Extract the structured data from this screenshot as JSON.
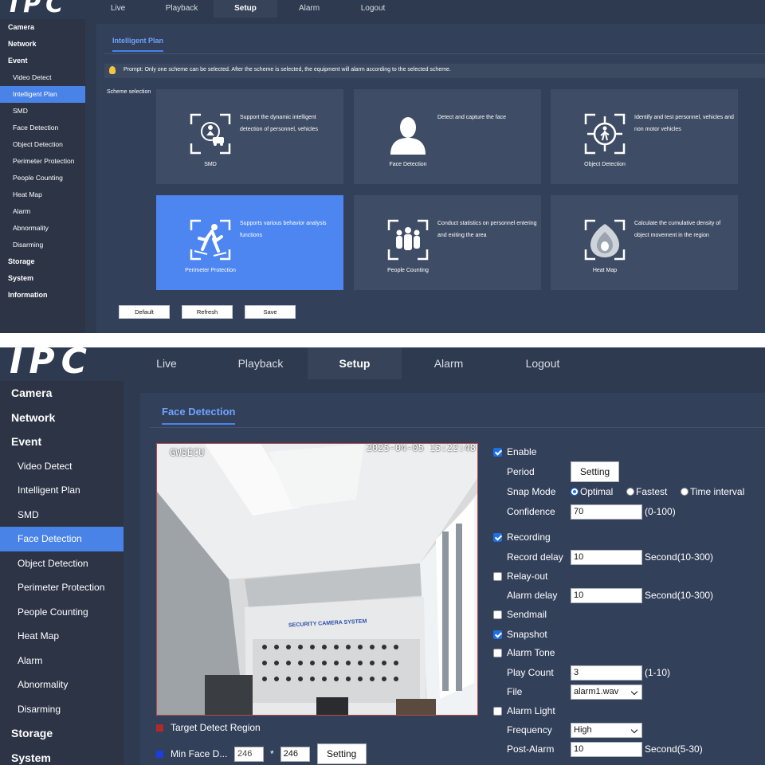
{
  "top_panel": {
    "logo_text": "IPC",
    "nav": [
      "Live",
      "Playback",
      "Setup",
      "Alarm",
      "Logout"
    ],
    "nav_active": 2,
    "sidebar": [
      {
        "label": "Camera",
        "group": true
      },
      {
        "label": "Network",
        "group": true
      },
      {
        "label": "Event",
        "group": true
      },
      {
        "label": "Video Detect",
        "group": false
      },
      {
        "label": "Intelligent Plan",
        "group": false,
        "active": true
      },
      {
        "label": "SMD",
        "group": false
      },
      {
        "label": "Face Detection",
        "group": false
      },
      {
        "label": "Object Detection",
        "group": false
      },
      {
        "label": "Perimeter Protection",
        "group": false
      },
      {
        "label": "People Counting",
        "group": false
      },
      {
        "label": "Heat Map",
        "group": false
      },
      {
        "label": "Alarm",
        "group": false
      },
      {
        "label": "Abnormality",
        "group": false
      },
      {
        "label": "Disarming",
        "group": false
      },
      {
        "label": "Storage",
        "group": true
      },
      {
        "label": "System",
        "group": true
      },
      {
        "label": "Information",
        "group": true
      }
    ],
    "tab_title": "Intelligent Plan",
    "prompt": "Prompt: Only one scheme can be selected. After the scheme is selected, the equipment will alarm according to the selected scheme.",
    "scheme_label": "Scheme selection",
    "cards": [
      {
        "name": "SMD",
        "desc": "Support the dynamic intelligent detection of personnel, vehicles",
        "icon": "smd-icon",
        "selected": false
      },
      {
        "name": "Face Detection",
        "desc": "Detect and capture the face",
        "icon": "face-icon",
        "selected": false
      },
      {
        "name": "Object Detection",
        "desc": "Identify and test personnel, vehicles and non motor vehicles",
        "icon": "object-icon",
        "selected": false
      },
      {
        "name": "Perimeter Protection",
        "desc": "Supports various behavior analysis functions",
        "icon": "perimeter-icon",
        "selected": true
      },
      {
        "name": "People Counting",
        "desc": "Conduct statistics on personnel entering and exiting the area",
        "icon": "people-icon",
        "selected": false
      },
      {
        "name": "Heat Map",
        "desc": "Calculate the cumulative density of object movement in the region",
        "icon": "heatmap-icon",
        "selected": false
      }
    ],
    "buttons": {
      "default": "Default",
      "refresh": "Refresh",
      "save": "Save"
    }
  },
  "bottom_panel": {
    "logo_text": "IPC",
    "nav": [
      "Live",
      "Playback",
      "Setup",
      "Alarm",
      "Logout"
    ],
    "nav_active": 2,
    "sidebar": [
      {
        "label": "Camera",
        "group": true
      },
      {
        "label": "Network",
        "group": true
      },
      {
        "label": "Event",
        "group": true
      },
      {
        "label": "Video Detect",
        "group": false
      },
      {
        "label": "Intelligent Plan",
        "group": false
      },
      {
        "label": "SMD",
        "group": false
      },
      {
        "label": "Face Detection",
        "group": false,
        "active": true
      },
      {
        "label": "Object Detection",
        "group": false
      },
      {
        "label": "Perimeter Protection",
        "group": false
      },
      {
        "label": "People Counting",
        "group": false
      },
      {
        "label": "Heat Map",
        "group": false
      },
      {
        "label": "Alarm",
        "group": false
      },
      {
        "label": "Abnormality",
        "group": false
      },
      {
        "label": "Disarming",
        "group": false
      },
      {
        "label": "Storage",
        "group": true
      },
      {
        "label": "System",
        "group": true
      }
    ],
    "tab_title": "Face Detection",
    "video": {
      "osd_name": "GWSECU",
      "osd_time": "2025-04-05 15:22:48",
      "wall_sign": "SECURITY CAMERA SYSTEM"
    },
    "legend": {
      "target_region": "Target Detect Region",
      "target_color": "#b3282d",
      "min_face": "Min Face D...",
      "min_face_color": "#1b3ee0",
      "min_w": "246",
      "min_sep": "*",
      "min_h": "246",
      "setting_btn": "Setting"
    },
    "form": {
      "enable": {
        "label": "Enable",
        "checked": true
      },
      "period": {
        "label": "Period",
        "button": "Setting"
      },
      "snap_mode": {
        "label": "Snap Mode",
        "options": [
          "Optimal",
          "Fastest",
          "Time interval"
        ],
        "selected": 0
      },
      "confidence": {
        "label": "Confidence",
        "value": "70",
        "unit": "(0-100)"
      },
      "recording": {
        "label": "Recording",
        "checked": true
      },
      "record_delay": {
        "label": "Record delay",
        "value": "10",
        "unit": "Second(10-300)"
      },
      "relay_out": {
        "label": "Relay-out",
        "checked": false
      },
      "alarm_delay": {
        "label": "Alarm delay",
        "value": "10",
        "unit": "Second(10-300)"
      },
      "sendmail": {
        "label": "Sendmail",
        "checked": false
      },
      "snapshot": {
        "label": "Snapshot",
        "checked": true
      },
      "alarm_tone": {
        "label": "Alarm Tone",
        "checked": false
      },
      "play_count": {
        "label": "Play Count",
        "value": "3",
        "unit": "(1-10)"
      },
      "file": {
        "label": "File",
        "value": "alarm1.wav"
      },
      "alarm_light": {
        "label": "Alarm Light",
        "checked": false
      },
      "frequency": {
        "label": "Frequency",
        "value": "High"
      },
      "post_alarm": {
        "label": "Post-Alarm",
        "value": "10",
        "unit": "Second(5-30)"
      }
    }
  }
}
